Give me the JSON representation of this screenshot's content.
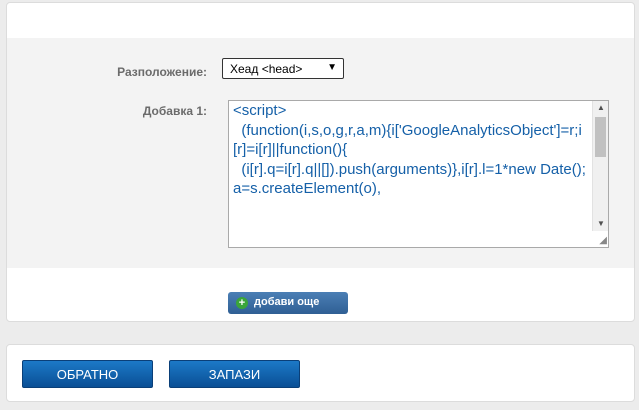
{
  "form": {
    "location_label": "Разположение:",
    "location_value": "Хеад <head>",
    "addon_label": "Добавка 1:",
    "addon_code": "<script>\n  (function(i,s,o,g,r,a,m){i['GoogleAnalyticsObject']=r;i[r]=i[r]||function(){\n  (i[r].q=i[r].q||[]).push(arguments)},i[r].l=1*new Date();a=s.createElement(o),",
    "add_more_label": "добави още"
  },
  "actions": {
    "back_label": "ОБРАТНО",
    "save_label": "ЗАПАЗИ"
  },
  "icons": {
    "dropdown": "triangle-down-icon",
    "add": "plus-circle-icon",
    "resize": "resize-grip-icon"
  },
  "colors": {
    "accent": "#1560a8",
    "button": "#0a5aa3",
    "add_green": "#3aa53a"
  }
}
